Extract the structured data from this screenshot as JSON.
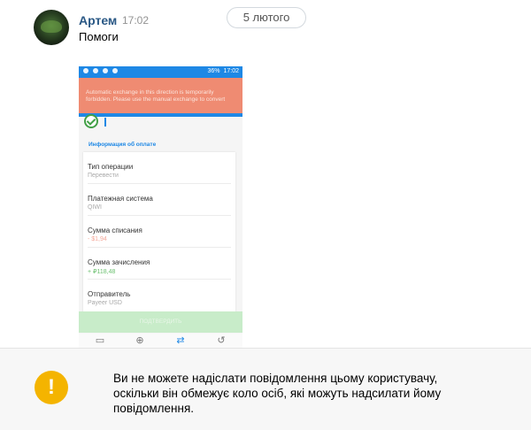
{
  "message": {
    "author": "Артем",
    "time": "17:02",
    "date": "5 лютого",
    "text": "Помоги"
  },
  "attachment": {
    "status_bar": {
      "battery": "36%",
      "clock": "17:02"
    },
    "banner_text": "Automatic exchange in this direction is temporarily forbidden. Please use the manual exchange to convert",
    "section_title": "Информация об оплате",
    "rows": [
      {
        "label": "Тип операции",
        "value": "Перевести",
        "value_color": "#a9a9a9"
      },
      {
        "label": "Платежная система",
        "value": "QIWI",
        "value_color": "#a9a9a9"
      },
      {
        "label": "Сумма списания",
        "value": "- $1,94",
        "value_color": "#f4a89a"
      },
      {
        "label": "Сумма зачисления",
        "value": "+ ₽118,48",
        "value_color": "#6cc070"
      },
      {
        "label": "Отправитель",
        "value": "Payeer USD",
        "value_color": "#a9a9a9"
      }
    ],
    "submit_label": "ПОДТВЕРДИТЬ",
    "nav_icons": [
      "wallet-icon",
      "plus-circle-icon",
      "exchange-icon",
      "history-icon"
    ],
    "accent_color": "#1e88e5"
  },
  "notice": {
    "icon": "!",
    "text": "Ви не можете надіслати повідомлення цьому користувачу, оскільки він обмежує коло осіб, які можуть надсилати йому повідомлення."
  }
}
